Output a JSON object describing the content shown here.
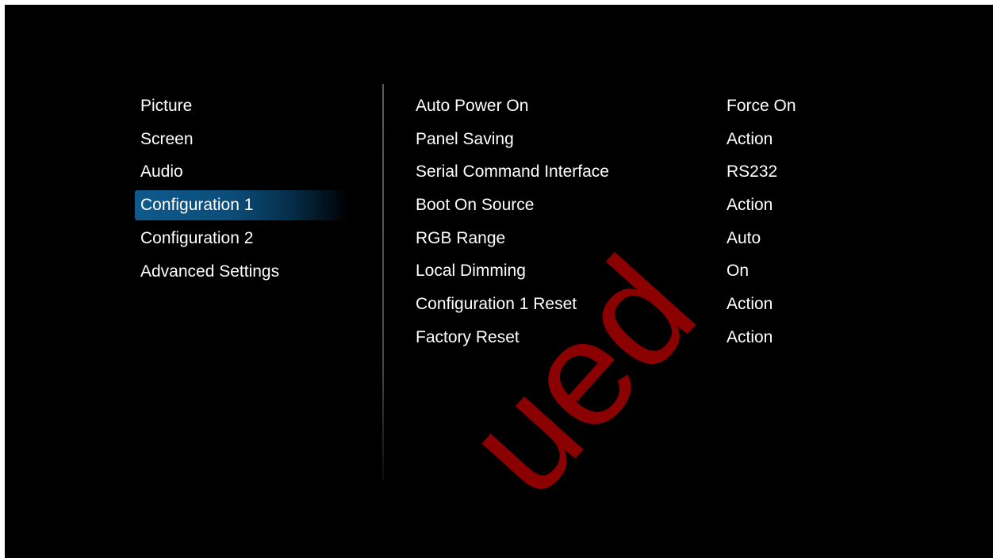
{
  "menu": {
    "items": [
      {
        "label": "Picture",
        "selected": false
      },
      {
        "label": "Screen",
        "selected": false
      },
      {
        "label": "Audio",
        "selected": false
      },
      {
        "label": "Configuration 1",
        "selected": true
      },
      {
        "label": "Configuration 2",
        "selected": false
      },
      {
        "label": "Advanced Settings",
        "selected": false
      }
    ]
  },
  "settings": {
    "rows": [
      {
        "label": "Auto Power On",
        "value": "Force On"
      },
      {
        "label": "Panel Saving",
        "value": "Action"
      },
      {
        "label": "Serial Command Interface",
        "value": "RS232"
      },
      {
        "label": "Boot On Source",
        "value": "Action"
      },
      {
        "label": "RGB Range",
        "value": "Auto"
      },
      {
        "label": "Local Dimming",
        "value": "On"
      },
      {
        "label": "Configuration 1 Reset",
        "value": "Action"
      },
      {
        "label": "Factory Reset",
        "value": "Action"
      }
    ]
  },
  "watermark": {
    "text": "ued",
    "color": "#8b0000"
  },
  "colors": {
    "background": "#000000",
    "text": "#ffffff",
    "selection": "#0e5a8d"
  }
}
